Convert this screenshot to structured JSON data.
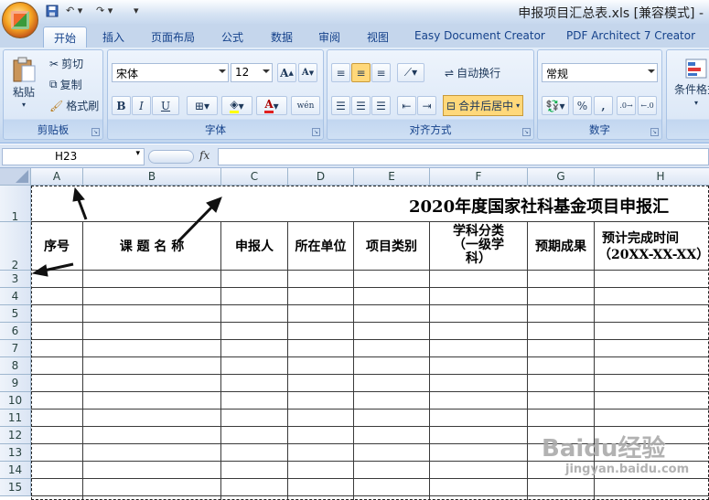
{
  "window": {
    "title": "申报项目汇总表.xls [兼容模式] -"
  },
  "tabs": [
    "开始",
    "插入",
    "页面布局",
    "公式",
    "数据",
    "审阅",
    "视图",
    "Easy Document Creator",
    "PDF Architect 7 Creator"
  ],
  "clipboard": {
    "paste": "粘贴",
    "cut": "剪切",
    "copy": "复制",
    "format_painter": "格式刷",
    "label": "剪贴板"
  },
  "font": {
    "name": "宋体",
    "size": "12",
    "label": "字体",
    "bold": "B",
    "italic": "I",
    "underline": "U",
    "grow": "A",
    "shrink": "A",
    "color_letter": "A",
    "phonetic": "wén"
  },
  "alignment": {
    "wrap": "自动换行",
    "merge": "合并后居中",
    "label": "对齐方式"
  },
  "number": {
    "format": "常规",
    "percent": "%",
    "comma": ",",
    "label": "数字"
  },
  "styles": {
    "conditional": "条件格式"
  },
  "namebox": {
    "value": "H23"
  },
  "formula": {
    "fx": "fx",
    "value": ""
  },
  "columns": [
    "A",
    "B",
    "C",
    "D",
    "E",
    "F",
    "G",
    "H"
  ],
  "rows": [
    "1",
    "2",
    "3",
    "4",
    "5",
    "6",
    "7",
    "8",
    "9",
    "10",
    "11",
    "12",
    "13",
    "14",
    "15"
  ],
  "sheet": {
    "title": "2020年度国家社科基金项目申报汇",
    "headers": {
      "A": "序号",
      "B": "课 题 名 称",
      "C": "申报人",
      "D": "所在单位",
      "E": "项目类别",
      "F": [
        "学科分类",
        "（一级学",
        "科）"
      ],
      "G": "预期成果",
      "H": [
        "预计完成时间",
        "（20XX-XX-XX）"
      ]
    }
  },
  "watermark": {
    "main": "Baidu经验",
    "sub": "jingyan.baidu.com"
  },
  "colors": {
    "ribbon": "#dce8f7",
    "header": "#dbe5f4",
    "active_tab": "#ffffff",
    "merge_highlight": "#ffd87a"
  }
}
